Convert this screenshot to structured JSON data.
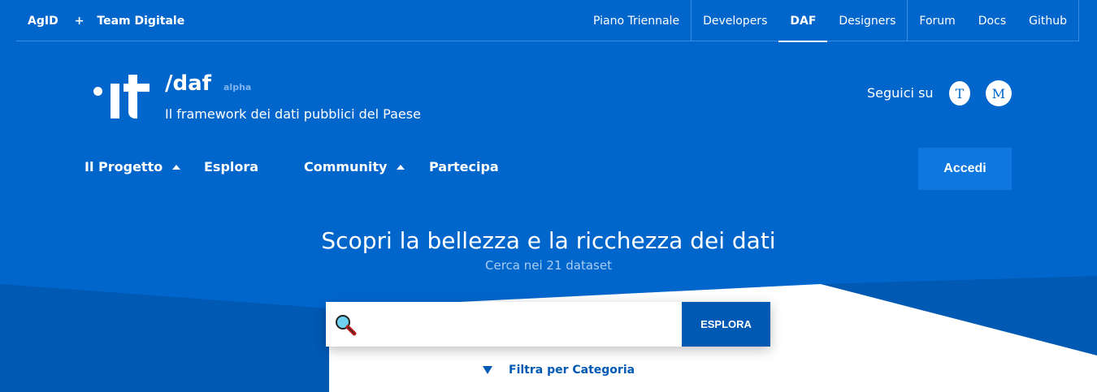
{
  "topbar": {
    "brand_agid": "AgID",
    "plus": "+",
    "brand_td": "Team Digitale",
    "links": [
      "Piano Triennale",
      "Developers",
      "DAF",
      "Designers",
      "Forum",
      "Docs",
      "Github"
    ],
    "active_link": "DAF"
  },
  "header": {
    "site_name": "/daf",
    "tag": "alpha",
    "subtitle": "Il framework dei dati pubblici del Paese",
    "follow_label": "Seguici su",
    "social": {
      "twitter_glyph": "T",
      "medium_glyph": "M"
    }
  },
  "nav": {
    "items": [
      "Il Progetto",
      "Esplora",
      "Community",
      "Partecipa"
    ],
    "login": "Accedi"
  },
  "hero": {
    "title": "Scopri la bellezza e la ricchezza dei dati",
    "subtitle": "Cerca nei 21 dataset"
  },
  "search": {
    "value": "",
    "button": "ESPLORA",
    "filter_label": "Filtra per Categoria"
  },
  "colors": {
    "background": "#0066cc",
    "button_dark": "#0059b3",
    "button_login": "#0e77e0"
  }
}
